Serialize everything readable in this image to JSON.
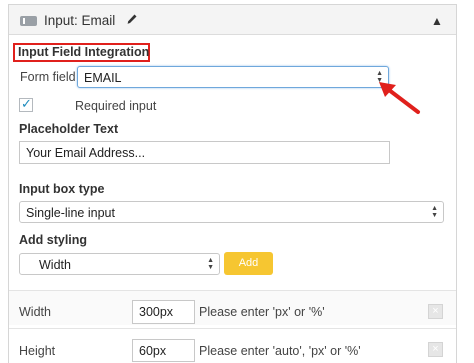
{
  "header": {
    "title": "Input: Email",
    "icon": "input-field-icon",
    "edit_icon": "pencil-icon",
    "collapse_icon": "triangle-up-icon",
    "collapse_glyph": "▲"
  },
  "section": {
    "title": "Input Field Integration",
    "highlight_color": "#e0201c"
  },
  "form_field": {
    "label": "Form field",
    "value": "EMAIL"
  },
  "required": {
    "checked": true,
    "check_glyph": "✓",
    "label": "Required input"
  },
  "placeholder": {
    "label": "Placeholder Text",
    "value": "Your Email Address..."
  },
  "input_box_type": {
    "label": "Input box type",
    "value": "Single-line input"
  },
  "styling": {
    "label": "Add styling",
    "select_value": "Width",
    "add_label": "Add",
    "add_color": "#f6c631"
  },
  "style_rows": [
    {
      "label": "Width",
      "value": "300px",
      "hint": "Please enter 'px' or '%'",
      "remove_glyph": "×"
    },
    {
      "label": "Height",
      "value": "60px",
      "hint": "Please enter 'auto', 'px' or '%'",
      "remove_glyph": "×"
    }
  ],
  "annotation": {
    "arrow_color": "#e0201c"
  }
}
